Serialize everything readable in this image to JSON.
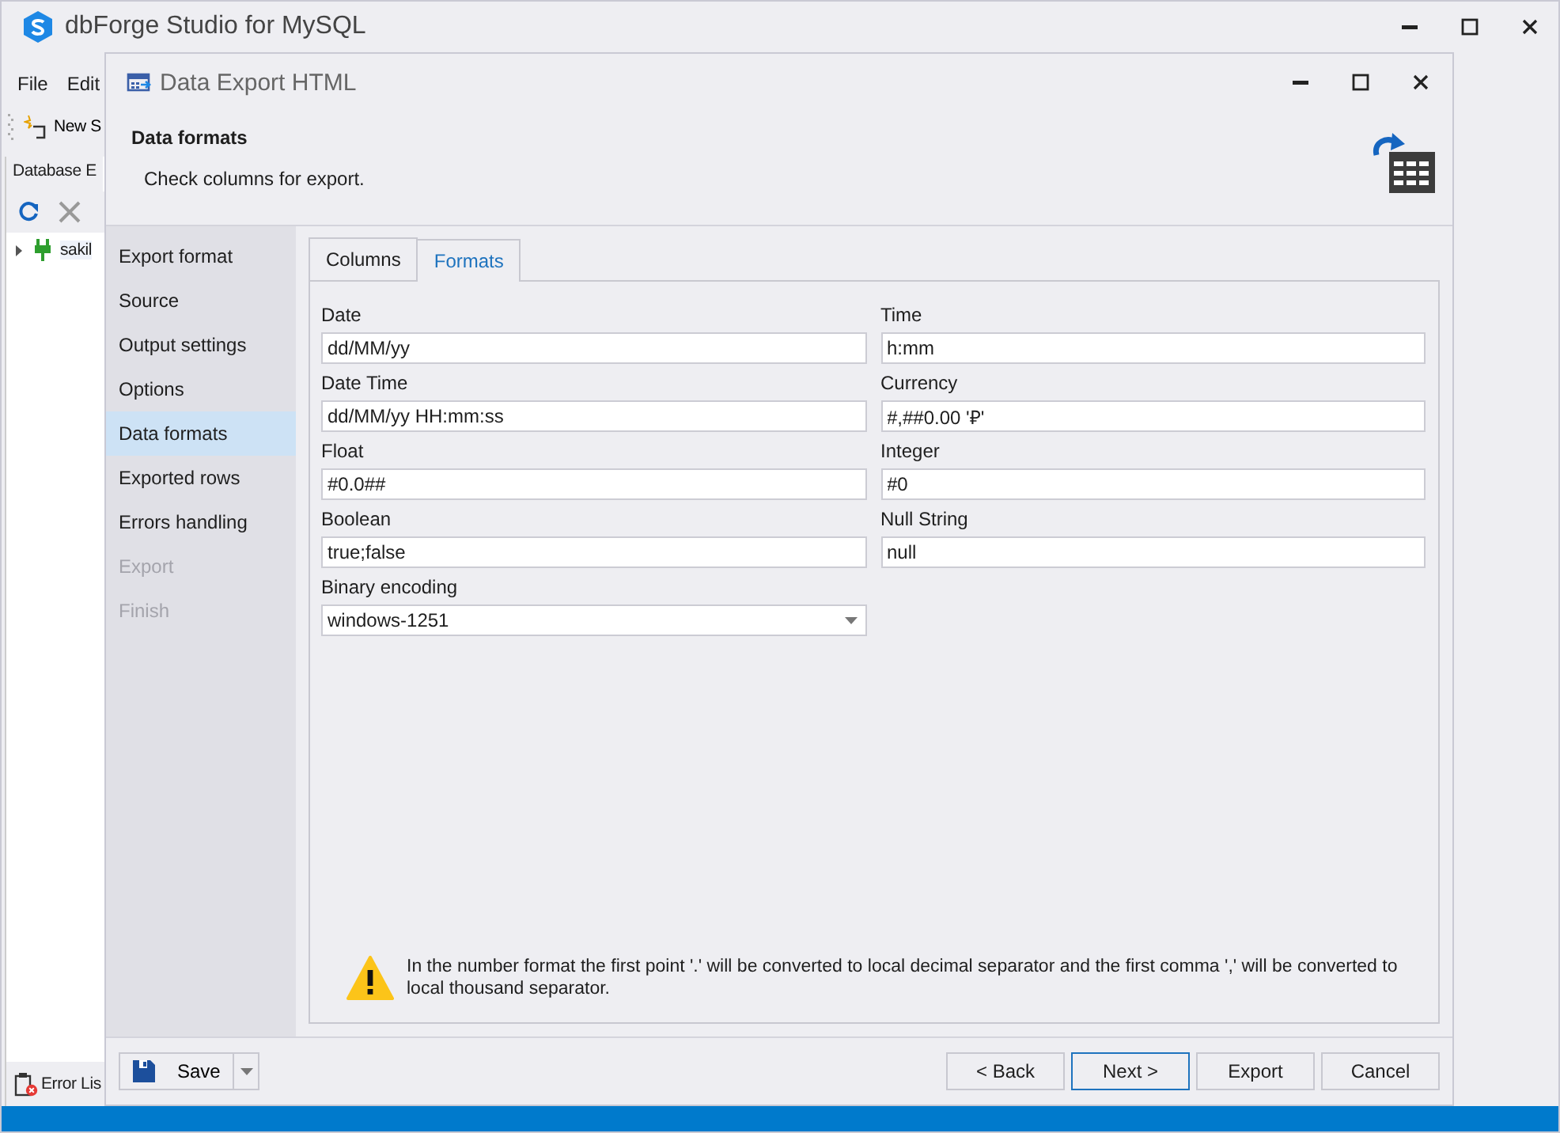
{
  "app": {
    "title": "dbForge Studio for MySQL",
    "menu": [
      {
        "label": "File"
      },
      {
        "label": "Edit"
      }
    ],
    "toolbar": [
      {
        "label": "New S"
      }
    ],
    "explorer": {
      "tab": "Database E",
      "tree": [
        {
          "label": "sakil",
          "expanded": false
        }
      ]
    },
    "error_tab": "Error Lis"
  },
  "dialog": {
    "title": "Data Export HTML",
    "header": {
      "title": "Data formats",
      "subtitle": "Check columns for export."
    },
    "steps": [
      {
        "label": "Export format",
        "selected": false,
        "disabled": false
      },
      {
        "label": "Source",
        "selected": false,
        "disabled": false
      },
      {
        "label": "Output settings",
        "selected": false,
        "disabled": false
      },
      {
        "label": "Options",
        "selected": false,
        "disabled": false
      },
      {
        "label": "Data formats",
        "selected": true,
        "disabled": false
      },
      {
        "label": "Exported rows",
        "selected": false,
        "disabled": false
      },
      {
        "label": "Errors handling",
        "selected": false,
        "disabled": false
      },
      {
        "label": "Export",
        "selected": false,
        "disabled": true
      },
      {
        "label": "Finish",
        "selected": false,
        "disabled": true
      }
    ],
    "tabs": [
      {
        "label": "Columns",
        "selected": false
      },
      {
        "label": "Formats",
        "selected": true
      }
    ],
    "fields": [
      {
        "label": "Date",
        "value": "dd/MM/yy",
        "kind": "text"
      },
      {
        "label": "Time",
        "value": "h:mm",
        "kind": "text"
      },
      {
        "label": "Date Time",
        "value": "dd/MM/yy HH:mm:ss",
        "kind": "text"
      },
      {
        "label": "Currency",
        "value": "#,##0.00 '₽'",
        "kind": "text"
      },
      {
        "label": "Float",
        "value": "#0.0##",
        "kind": "text"
      },
      {
        "label": "Integer",
        "value": "#0",
        "kind": "text"
      },
      {
        "label": "Boolean",
        "value": "true;false",
        "kind": "text"
      },
      {
        "label": "Null String",
        "value": "null",
        "kind": "text"
      },
      {
        "label": "Binary encoding",
        "value": "windows-1251",
        "kind": "dropdown"
      }
    ],
    "note": "In the number format the first point '.' will be converted to local decimal separator and the first comma ',' will be converted to local thousand separator.",
    "save": "Save",
    "buttons": [
      {
        "label": "< Back",
        "default": false
      },
      {
        "label": "Next >",
        "default": true
      },
      {
        "label": "Export",
        "default": false
      },
      {
        "label": "Cancel",
        "default": false
      }
    ]
  }
}
